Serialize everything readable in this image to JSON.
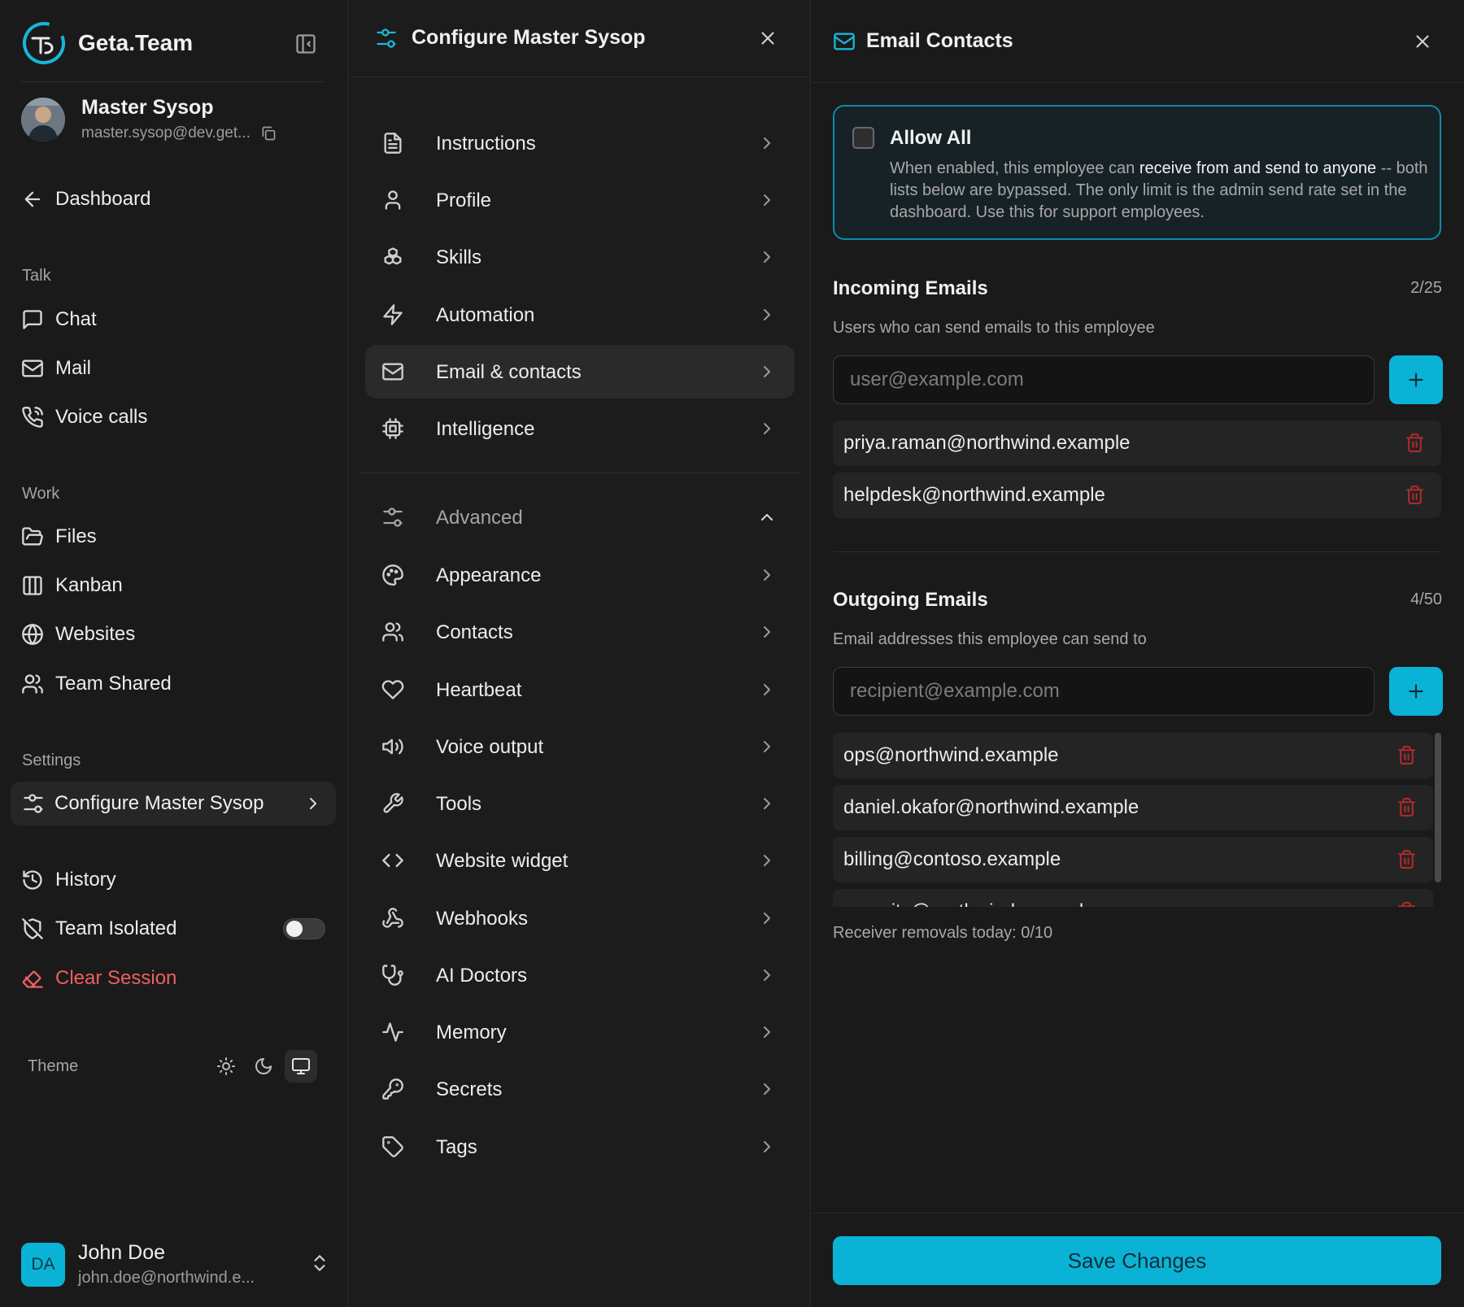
{
  "brand": {
    "name": "Geta.Team",
    "logo_icon": "geta-team-logo"
  },
  "current_user_card": {
    "name": "Master Sysop",
    "email": "master.sysop@dev.get..."
  },
  "sidebar": {
    "back": {
      "label": "Dashboard",
      "icon": "arrow-left-icon"
    },
    "sections": {
      "talk": "Talk",
      "work": "Work",
      "settings": "Settings"
    },
    "talk_items": [
      {
        "label": "Chat",
        "icon": "message-square-icon"
      },
      {
        "label": "Mail",
        "icon": "mail-icon"
      },
      {
        "label": "Voice calls",
        "icon": "phone-call-icon"
      }
    ],
    "work_items": [
      {
        "label": "Files",
        "icon": "folder-open-icon"
      },
      {
        "label": "Kanban",
        "icon": "kanban-icon"
      },
      {
        "label": "Websites",
        "icon": "globe-icon"
      },
      {
        "label": "Team Shared",
        "icon": "users-icon"
      }
    ],
    "settings_active": {
      "label": "Configure Master Sysop",
      "icon": "settings-sliders-icon"
    },
    "bottom_items": [
      {
        "label": "History",
        "icon": "history-icon"
      },
      {
        "label": "Team Isolated",
        "icon": "shield-off-icon",
        "toggle_on": false
      },
      {
        "label": "Clear Session",
        "icon": "eraser-icon",
        "color": "#ef5f5f"
      }
    ],
    "theme": {
      "label": "Theme",
      "options": [
        "light",
        "dark",
        "system"
      ],
      "selected": "system"
    }
  },
  "account": {
    "initials": "DA",
    "name": "John Doe",
    "email": "john.doe@northwind.e..."
  },
  "config_panel": {
    "title": "Configure Master Sysop",
    "items": [
      {
        "label": "Instructions",
        "icon": "file-text-icon"
      },
      {
        "label": "Profile",
        "icon": "user-icon"
      },
      {
        "label": "Skills",
        "icon": "boxes-icon"
      },
      {
        "label": "Automation",
        "icon": "zap-icon"
      },
      {
        "label": "Email & contacts",
        "icon": "mail-icon",
        "selected": true
      },
      {
        "label": "Intelligence",
        "icon": "cpu-icon"
      }
    ],
    "advanced": {
      "label": "Advanced",
      "expanded": true
    },
    "advanced_items": [
      {
        "label": "Appearance",
        "icon": "palette-icon"
      },
      {
        "label": "Contacts",
        "icon": "users-icon"
      },
      {
        "label": "Heartbeat",
        "icon": "heart-icon"
      },
      {
        "label": "Voice output",
        "icon": "volume-icon"
      },
      {
        "label": "Tools",
        "icon": "wrench-icon"
      },
      {
        "label": "Website widget",
        "icon": "code-icon"
      },
      {
        "label": "Webhooks",
        "icon": "webhook-icon"
      },
      {
        "label": "AI Doctors",
        "icon": "stethoscope-icon"
      },
      {
        "label": "Memory",
        "icon": "activity-icon"
      },
      {
        "label": "Secrets",
        "icon": "key-icon"
      },
      {
        "label": "Tags",
        "icon": "tag-icon"
      }
    ]
  },
  "email_panel": {
    "title": "Email Contacts",
    "allow_all": {
      "title": "Allow All",
      "checked": false,
      "desc_before": "When enabled, this employee can ",
      "desc_bold": "receive from and send to anyone",
      "desc_after": " -- both lists below are bypassed. The only limit is the admin send rate set in the dashboard. Use this for support employees."
    },
    "incoming": {
      "title": "Incoming Emails",
      "count": "2/25",
      "subtitle": "Users who can send emails to this employee",
      "placeholder": "user@example.com",
      "emails": [
        "priya.raman@northwind.example",
        "helpdesk@northwind.example"
      ]
    },
    "outgoing": {
      "title": "Outgoing Emails",
      "count": "4/50",
      "subtitle": "Email addresses this employee can send to",
      "placeholder": "recipient@example.com",
      "emails": [
        "ops@northwind.example",
        "daniel.okafor@northwind.example",
        "billing@contoso.example",
        "security@northwind.example"
      ]
    },
    "removals": "Receiver removals today: 0/10",
    "save_label": "Save Changes",
    "accent": "#0ab3d6"
  }
}
